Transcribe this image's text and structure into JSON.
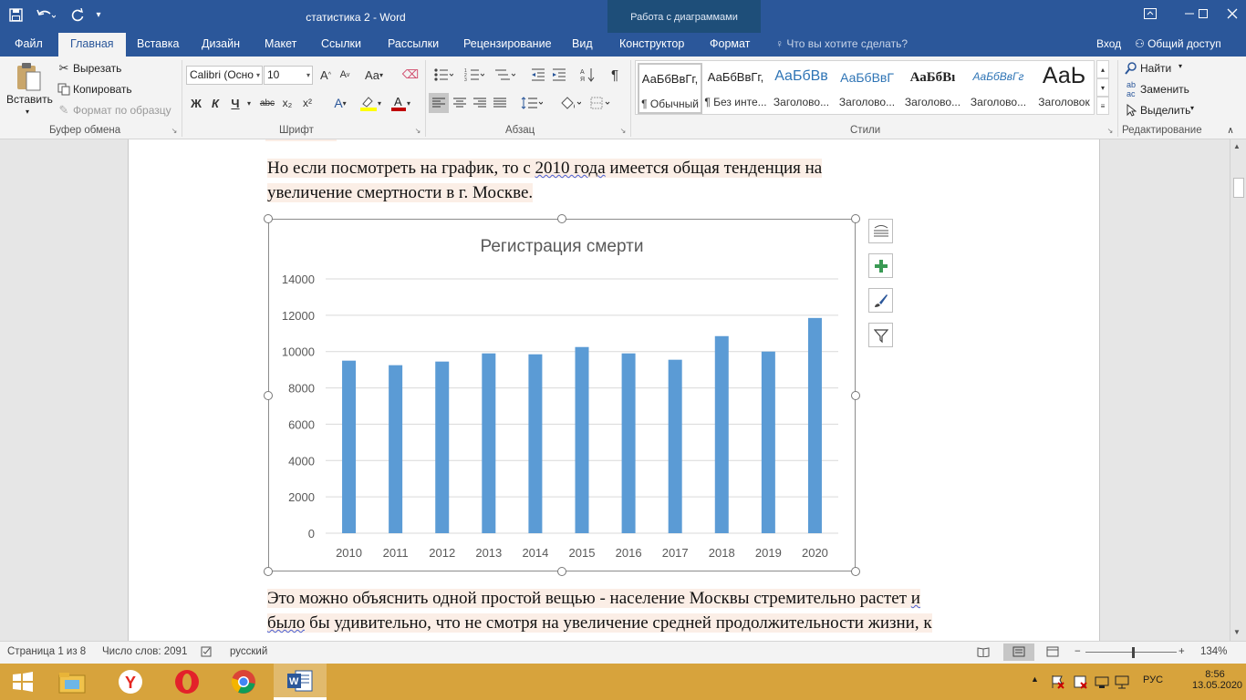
{
  "title_bar": {
    "document_title": "статистика 2 - Word",
    "context_group": "Работа с диаграммами"
  },
  "tabs": [
    {
      "label": "Файл"
    },
    {
      "label": "Главная"
    },
    {
      "label": "Вставка"
    },
    {
      "label": "Дизайн"
    },
    {
      "label": "Макет"
    },
    {
      "label": "Ссылки"
    },
    {
      "label": "Рассылки"
    },
    {
      "label": "Рецензирование"
    },
    {
      "label": "Вид"
    },
    {
      "label": "Конструктор"
    },
    {
      "label": "Формат"
    }
  ],
  "tell_me": "Что вы хотите сделать?",
  "sign_in": "Вход",
  "share": "Общий доступ",
  "ribbon": {
    "clipboard": {
      "paste": "Вставить",
      "cut": "Вырезать",
      "copy": "Копировать",
      "format_painter": "Формат по образцу",
      "group_label": "Буфер обмена"
    },
    "font": {
      "font_name": "Calibri (Осно",
      "font_size": "10",
      "bold": "Ж",
      "italic": "К",
      "underline": "Ч",
      "strikethrough": "abc",
      "subscript": "x₂",
      "superscript": "x²",
      "grow": "A",
      "shrink": "A",
      "change_case": "Aa",
      "group_label": "Шрифт"
    },
    "paragraph": {
      "pilcrow": "¶",
      "group_label": "Абзац"
    },
    "styles": {
      "items": [
        {
          "sample": "АаБбВвГг,",
          "name": "¶ Обычный"
        },
        {
          "sample": "АаБбВвГг,",
          "name": "¶ Без инте..."
        },
        {
          "sample": "АаБбВв",
          "name": "Заголово..."
        },
        {
          "sample": "АаБбВвГ",
          "name": "Заголово..."
        },
        {
          "sample": "АаБбВı",
          "name": "Заголово..."
        },
        {
          "sample": "АаБбВвГг",
          "name": "Заголово..."
        },
        {
          "sample": "АаЬ",
          "name": "Заголовок"
        }
      ],
      "group_label": "Стили"
    },
    "editing": {
      "find": "Найти",
      "replace": "Заменить",
      "select": "Выделить",
      "group_label": "Редактирование"
    }
  },
  "document": {
    "para1_line1_parts": [
      "Но   если посмотреть   на график, то   с ",
      "2010  года",
      "  имеется общая   тенденция   на"
    ],
    "para1_line2": "увеличение смертности в г.  Москве.",
    "para2_line1": "Это   можно объяснить одной простой вещью   - население Москвы стремительно растет ",
    "para2_line1_end": "и",
    "para2_line2_start": "было",
    "para2_line2_rest": " бы удивительно, что не смотря на увеличение средней продолжительности  жизни,  к"
  },
  "chart_data": {
    "type": "bar",
    "title": "Регистрация смерти",
    "categories": [
      "2010",
      "2011",
      "2012",
      "2013",
      "2014",
      "2015",
      "2016",
      "2017",
      "2018",
      "2019",
      "2020"
    ],
    "values": [
      9500,
      9250,
      9450,
      9900,
      9850,
      10250,
      9900,
      9550,
      10850,
      10000,
      11850
    ],
    "ylim": [
      0,
      14000
    ],
    "yticks": [
      0,
      2000,
      4000,
      6000,
      8000,
      10000,
      12000,
      14000
    ],
    "xlabel": "",
    "ylabel": "",
    "grid": true,
    "legend": "none",
    "bar_color": "#5b9bd5"
  },
  "status": {
    "page": "Страница 1 из 8",
    "words": "Число слов: 2091",
    "language": "русский",
    "zoom": "134%"
  },
  "taskbar": {
    "language": "РУС",
    "time": "8:56",
    "date": "13.05.2020"
  },
  "colors": {
    "word_blue": "#2b579a",
    "context_tab": "#1e4e79",
    "taskbar": "#d7a33c"
  }
}
